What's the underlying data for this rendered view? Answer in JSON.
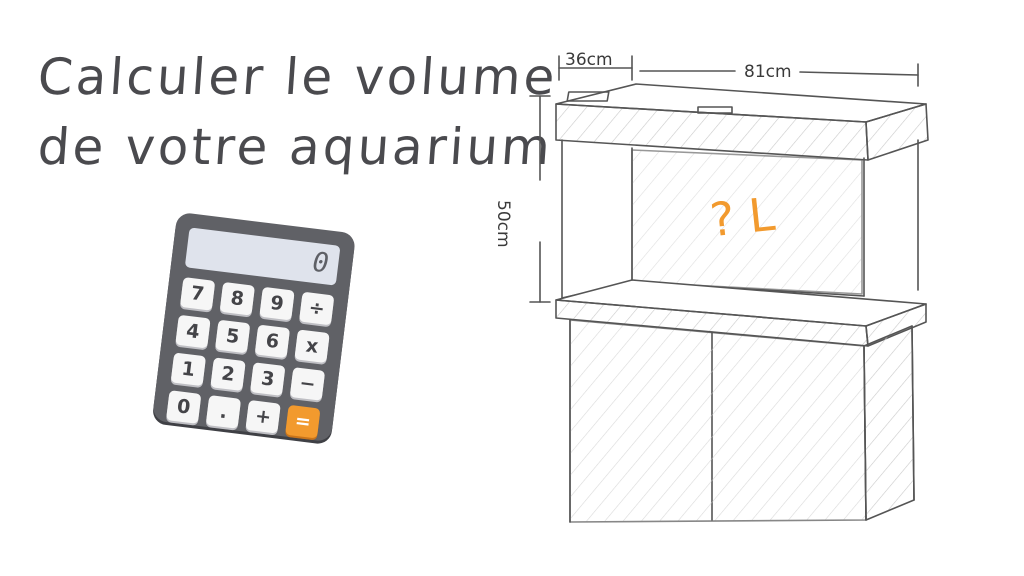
{
  "title": {
    "line1": "Calculer le volume",
    "line2": "de votre aquarium"
  },
  "calculator": {
    "display": "0",
    "keys": [
      "7",
      "8",
      "9",
      "÷",
      "4",
      "5",
      "6",
      "x",
      "1",
      "2",
      "3",
      "−",
      "0",
      ".",
      "+",
      "="
    ],
    "accent_color": "#f29a2e",
    "body_color": "#606166"
  },
  "aquarium": {
    "depth_label": "36cm",
    "width_label": "81cm",
    "height_label": "50cm",
    "volume_label": "? L"
  }
}
